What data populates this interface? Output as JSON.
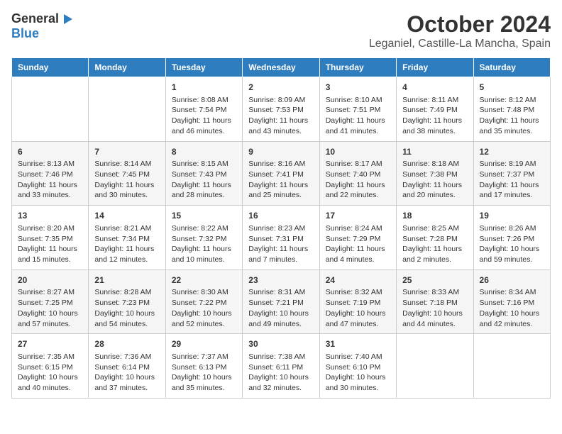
{
  "logo": {
    "general": "General",
    "blue": "Blue"
  },
  "title": "October 2024",
  "subtitle": "Leganiel, Castille-La Mancha, Spain",
  "days_of_week": [
    "Sunday",
    "Monday",
    "Tuesday",
    "Wednesday",
    "Thursday",
    "Friday",
    "Saturday"
  ],
  "weeks": [
    [
      {
        "day": "",
        "content": ""
      },
      {
        "day": "",
        "content": ""
      },
      {
        "day": "1",
        "content": "Sunrise: 8:08 AM\nSunset: 7:54 PM\nDaylight: 11 hours and 46 minutes."
      },
      {
        "day": "2",
        "content": "Sunrise: 8:09 AM\nSunset: 7:53 PM\nDaylight: 11 hours and 43 minutes."
      },
      {
        "day": "3",
        "content": "Sunrise: 8:10 AM\nSunset: 7:51 PM\nDaylight: 11 hours and 41 minutes."
      },
      {
        "day": "4",
        "content": "Sunrise: 8:11 AM\nSunset: 7:49 PM\nDaylight: 11 hours and 38 minutes."
      },
      {
        "day": "5",
        "content": "Sunrise: 8:12 AM\nSunset: 7:48 PM\nDaylight: 11 hours and 35 minutes."
      }
    ],
    [
      {
        "day": "6",
        "content": "Sunrise: 8:13 AM\nSunset: 7:46 PM\nDaylight: 11 hours and 33 minutes."
      },
      {
        "day": "7",
        "content": "Sunrise: 8:14 AM\nSunset: 7:45 PM\nDaylight: 11 hours and 30 minutes."
      },
      {
        "day": "8",
        "content": "Sunrise: 8:15 AM\nSunset: 7:43 PM\nDaylight: 11 hours and 28 minutes."
      },
      {
        "day": "9",
        "content": "Sunrise: 8:16 AM\nSunset: 7:41 PM\nDaylight: 11 hours and 25 minutes."
      },
      {
        "day": "10",
        "content": "Sunrise: 8:17 AM\nSunset: 7:40 PM\nDaylight: 11 hours and 22 minutes."
      },
      {
        "day": "11",
        "content": "Sunrise: 8:18 AM\nSunset: 7:38 PM\nDaylight: 11 hours and 20 minutes."
      },
      {
        "day": "12",
        "content": "Sunrise: 8:19 AM\nSunset: 7:37 PM\nDaylight: 11 hours and 17 minutes."
      }
    ],
    [
      {
        "day": "13",
        "content": "Sunrise: 8:20 AM\nSunset: 7:35 PM\nDaylight: 11 hours and 15 minutes."
      },
      {
        "day": "14",
        "content": "Sunrise: 8:21 AM\nSunset: 7:34 PM\nDaylight: 11 hours and 12 minutes."
      },
      {
        "day": "15",
        "content": "Sunrise: 8:22 AM\nSunset: 7:32 PM\nDaylight: 11 hours and 10 minutes."
      },
      {
        "day": "16",
        "content": "Sunrise: 8:23 AM\nSunset: 7:31 PM\nDaylight: 11 hours and 7 minutes."
      },
      {
        "day": "17",
        "content": "Sunrise: 8:24 AM\nSunset: 7:29 PM\nDaylight: 11 hours and 4 minutes."
      },
      {
        "day": "18",
        "content": "Sunrise: 8:25 AM\nSunset: 7:28 PM\nDaylight: 11 hours and 2 minutes."
      },
      {
        "day": "19",
        "content": "Sunrise: 8:26 AM\nSunset: 7:26 PM\nDaylight: 10 hours and 59 minutes."
      }
    ],
    [
      {
        "day": "20",
        "content": "Sunrise: 8:27 AM\nSunset: 7:25 PM\nDaylight: 10 hours and 57 minutes."
      },
      {
        "day": "21",
        "content": "Sunrise: 8:28 AM\nSunset: 7:23 PM\nDaylight: 10 hours and 54 minutes."
      },
      {
        "day": "22",
        "content": "Sunrise: 8:30 AM\nSunset: 7:22 PM\nDaylight: 10 hours and 52 minutes."
      },
      {
        "day": "23",
        "content": "Sunrise: 8:31 AM\nSunset: 7:21 PM\nDaylight: 10 hours and 49 minutes."
      },
      {
        "day": "24",
        "content": "Sunrise: 8:32 AM\nSunset: 7:19 PM\nDaylight: 10 hours and 47 minutes."
      },
      {
        "day": "25",
        "content": "Sunrise: 8:33 AM\nSunset: 7:18 PM\nDaylight: 10 hours and 44 minutes."
      },
      {
        "day": "26",
        "content": "Sunrise: 8:34 AM\nSunset: 7:16 PM\nDaylight: 10 hours and 42 minutes."
      }
    ],
    [
      {
        "day": "27",
        "content": "Sunrise: 7:35 AM\nSunset: 6:15 PM\nDaylight: 10 hours and 40 minutes."
      },
      {
        "day": "28",
        "content": "Sunrise: 7:36 AM\nSunset: 6:14 PM\nDaylight: 10 hours and 37 minutes."
      },
      {
        "day": "29",
        "content": "Sunrise: 7:37 AM\nSunset: 6:13 PM\nDaylight: 10 hours and 35 minutes."
      },
      {
        "day": "30",
        "content": "Sunrise: 7:38 AM\nSunset: 6:11 PM\nDaylight: 10 hours and 32 minutes."
      },
      {
        "day": "31",
        "content": "Sunrise: 7:40 AM\nSunset: 6:10 PM\nDaylight: 10 hours and 30 minutes."
      },
      {
        "day": "",
        "content": ""
      },
      {
        "day": "",
        "content": ""
      }
    ]
  ]
}
